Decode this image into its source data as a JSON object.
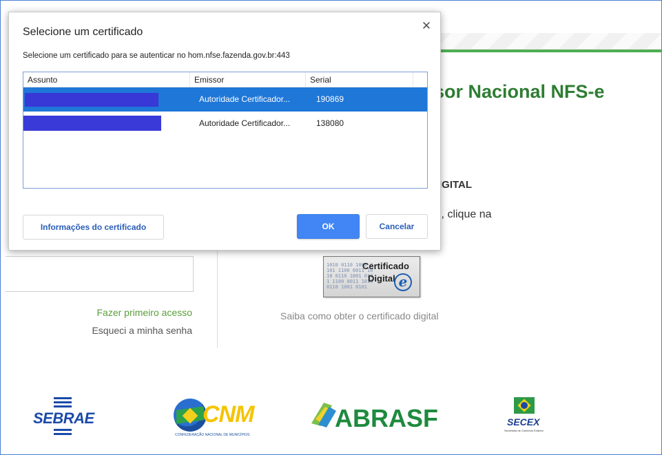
{
  "page": {
    "title": "sor Nacional NFS-e",
    "subtitle": "IGITAL",
    "instruction": "l, clique na",
    "first_access_link": "Fazer primeiro acesso",
    "forgot_password_link": "Esqueci a minha senha",
    "cert_badge": {
      "line1": "Certificado",
      "line2": "Digital",
      "mark": "e"
    },
    "cert_caption": "Saiba como obter o certificado digital",
    "logos": {
      "sebrae": "SEBRAE",
      "cnm": "CNM",
      "cnm_sub": "CONFEDERAÇÃO NACIONAL DE MUNICÍPIOS",
      "abrasf": "ABRASF",
      "secex": "SECEX",
      "secex_sub": "Secretaria de Comércio Exterior"
    },
    "colors": {
      "green": "#2e7d32",
      "accent_green_line": "#4caf50",
      "link_green": "#5a9e3a"
    }
  },
  "dialog": {
    "title": "Selecione um certificado",
    "description": "Selecione um certificado para se autenticar no hom.nfse.fazenda.gov.br:443",
    "close_icon": "close-icon",
    "columns": [
      "Assunto",
      "Emissor",
      "Serial"
    ],
    "rows": [
      {
        "subject": "",
        "issuer": "Autoridade Certificador...",
        "serial": "190869",
        "selected": true
      },
      {
        "subject": "",
        "issuer": "Autoridade Certificador...",
        "serial": "138080",
        "selected": false
      }
    ],
    "buttons": {
      "info": "Informações do certificado",
      "ok": "OK",
      "cancel": "Cancelar"
    },
    "colors": {
      "selection": "#1f77d8",
      "primary_button": "#4285f4",
      "redaction": "#3838d6"
    }
  }
}
